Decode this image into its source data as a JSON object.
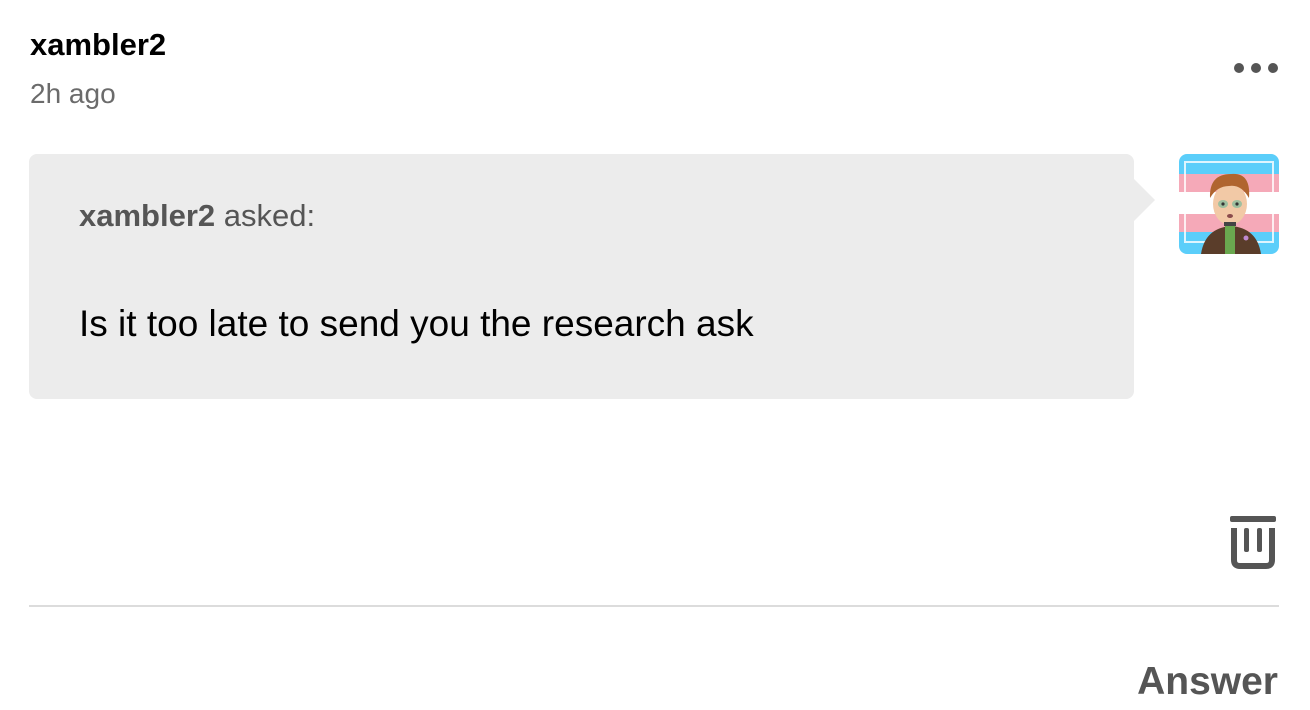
{
  "post": {
    "author": "xambler2",
    "time": "2h ago"
  },
  "ask": {
    "asker": "xambler2",
    "asked_suffix": " asked:",
    "question": "Is it too late to send you the research ask"
  },
  "actions": {
    "more_icon": "ellipsis-icon",
    "delete_icon": "trash-icon",
    "answer_label": "Answer"
  },
  "colors": {
    "bubble": "#ececec",
    "muted_text": "#6b6b6b",
    "avatar_blue": "#5bcefa",
    "avatar_pink": "#f5a9b8"
  }
}
